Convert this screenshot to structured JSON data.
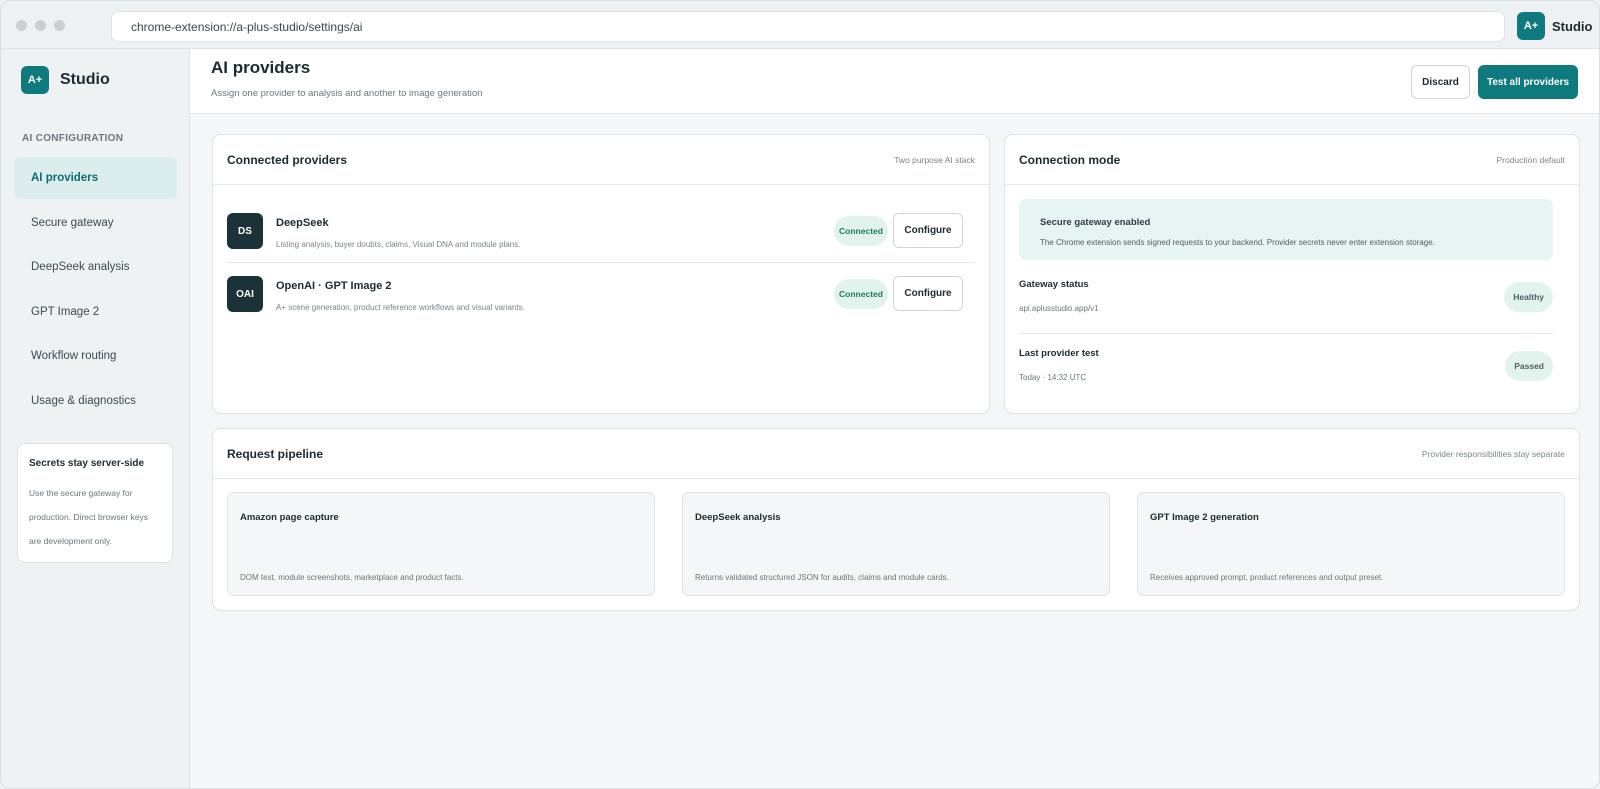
{
  "browser": {
    "url": "chrome-extension://a-plus-studio/settings/ai",
    "brand_badge": "A+",
    "brand_name": "Studio"
  },
  "sidebar": {
    "brand_badge": "A+",
    "brand_name": "Studio",
    "section_label": "AI CONFIGURATION",
    "items": [
      {
        "label": "AI providers",
        "active": true
      },
      {
        "label": "Secure gateway"
      },
      {
        "label": "DeepSeek analysis"
      },
      {
        "label": "GPT Image 2"
      },
      {
        "label": "Workflow routing"
      },
      {
        "label": "Usage & diagnostics"
      }
    ],
    "secret_card": {
      "title": "Secrets stay server-side",
      "body": "Use the secure gateway for production. Direct browser keys are development only."
    }
  },
  "header": {
    "title": "AI providers",
    "subtitle": "Assign one provider to analysis and another to image generation",
    "discard_label": "Discard",
    "test_label": "Test all providers"
  },
  "providers_card": {
    "title": "Connected providers",
    "note": "Two purpose AI stack",
    "providers": [
      {
        "avatar": "DS",
        "name": "DeepSeek",
        "description": "Listing analysis, buyer doubts, claims, Visual DNA and module plans.",
        "status": "Connected",
        "action": "Configure"
      },
      {
        "avatar": "OAI",
        "name": "OpenAI · GPT Image 2",
        "description": "A+ scene generation, product reference workflows and visual variants.",
        "status": "Connected",
        "action": "Configure"
      }
    ]
  },
  "connection_card": {
    "title": "Connection mode",
    "note": "Production default",
    "gateway": {
      "title": "Secure gateway enabled",
      "description": "The Chrome extension sends signed requests to your backend. Provider secrets never enter extension storage."
    },
    "rows": [
      {
        "label": "Gateway status",
        "value": "api.aplusstudio.app/v1",
        "pill": "Healthy"
      },
      {
        "label": "Last provider test",
        "value": "Today · 14:32 UTC",
        "pill": "Passed"
      }
    ]
  },
  "pipeline_card": {
    "title": "Request pipeline",
    "note": "Provider responsibilities stay separate",
    "steps": [
      {
        "title": "Amazon page capture",
        "description": "DOM text, module screenshots, marketplace and product facts."
      },
      {
        "title": "DeepSeek analysis",
        "description": "Returns validated structured JSON for audits, claims and module cards."
      },
      {
        "title": "GPT Image 2 generation",
        "description": "Receives approved prompt, product references and output preset."
      }
    ]
  },
  "colors": {
    "accent": "#0f7a7e",
    "active_nav_bg": "#dcedee",
    "connected_badge_bg": "#e2f3ee",
    "provider_avatar_bg": "#1a3238"
  }
}
